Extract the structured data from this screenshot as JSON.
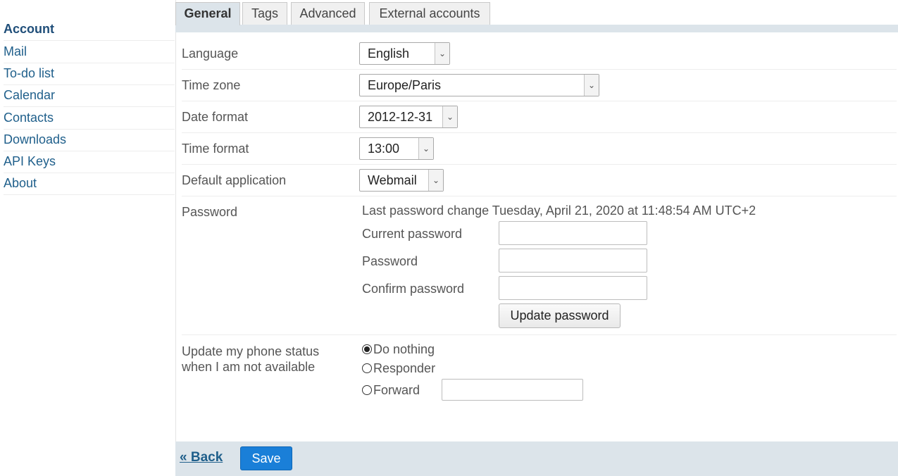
{
  "sidebar": {
    "items": [
      {
        "label": "Account"
      },
      {
        "label": "Mail"
      },
      {
        "label": "To-do list"
      },
      {
        "label": "Calendar"
      },
      {
        "label": "Contacts"
      },
      {
        "label": "Downloads"
      },
      {
        "label": "API Keys"
      },
      {
        "label": "About"
      }
    ]
  },
  "tabs": [
    {
      "label": "General",
      "active": true
    },
    {
      "label": "Tags"
    },
    {
      "label": "Advanced"
    },
    {
      "label": "External accounts"
    }
  ],
  "form": {
    "language": {
      "label": "Language",
      "value": "English"
    },
    "timezone": {
      "label": "Time zone",
      "value": "Europe/Paris"
    },
    "date_format": {
      "label": "Date format",
      "value": "2012-12-31"
    },
    "time_format": {
      "label": "Time format",
      "value": "13:00"
    },
    "default_app": {
      "label": "Default application",
      "value": "Webmail"
    },
    "password": {
      "label": "Password",
      "last_change": "Last password change Tuesday, April 21, 2020 at 11:48:54 AM UTC+2",
      "current_label": "Current password",
      "new_label": "Password",
      "confirm_label": "Confirm password",
      "current_value": "",
      "new_value": "",
      "confirm_value": "",
      "update_button": "Update password"
    },
    "phone_status": {
      "label_line1": "Update my phone status",
      "label_line2": "when I am not available",
      "options": [
        {
          "label": "Do nothing",
          "checked": true
        },
        {
          "label": "Responder",
          "checked": false
        },
        {
          "label": "Forward",
          "checked": false
        }
      ],
      "forward_value": ""
    }
  },
  "footer": {
    "back_label": "« Back",
    "save_label": "Save"
  },
  "colors": {
    "accent": "#1a7fd8",
    "link": "#1f5f8b",
    "tab_strip": "#dce4ea"
  }
}
